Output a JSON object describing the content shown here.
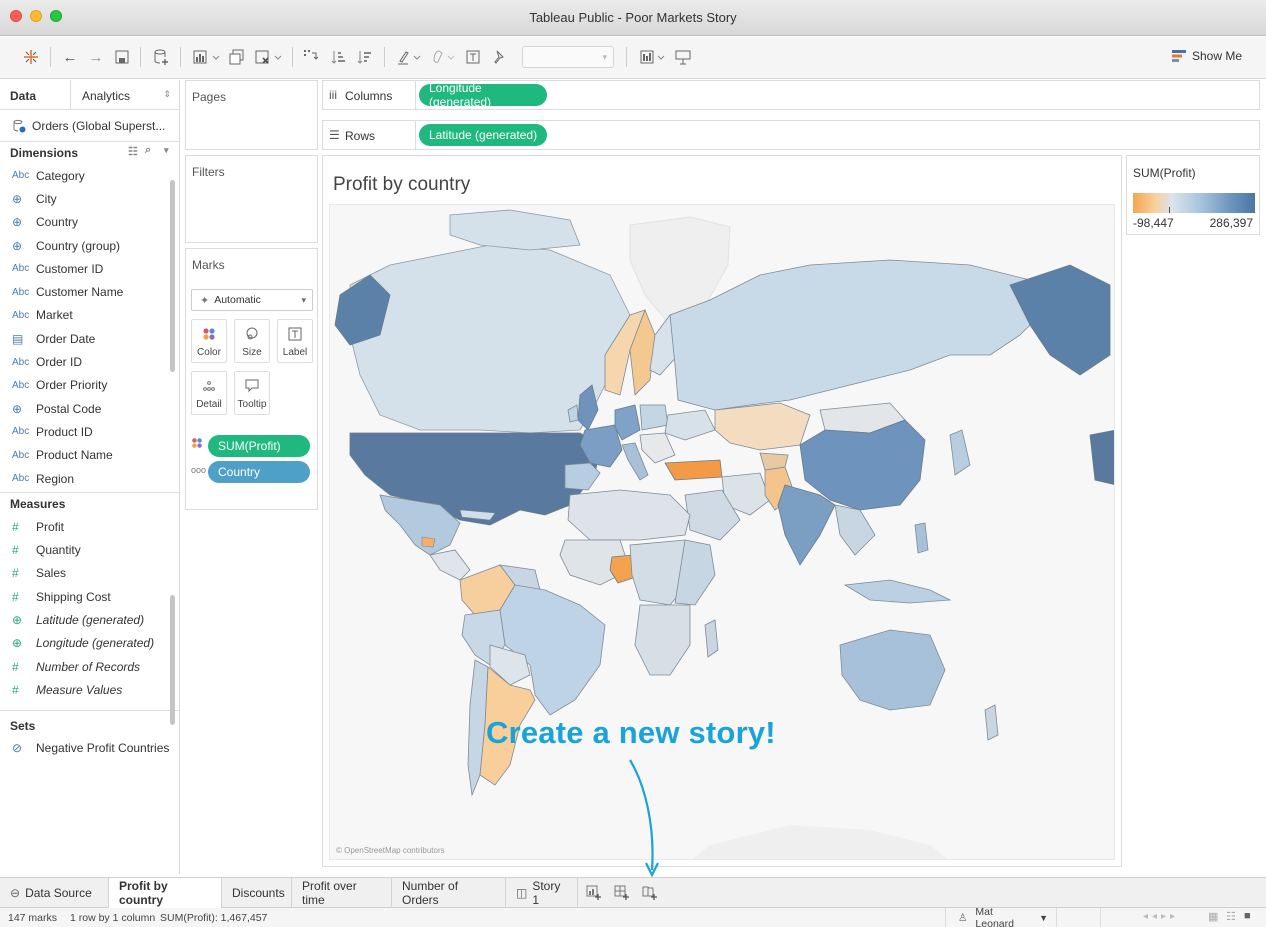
{
  "window": {
    "title": "Tableau Public - Poor Markets Story"
  },
  "toolbar": {
    "show_me_label": "Show Me"
  },
  "left_panel": {
    "tabs": [
      {
        "label": "Data"
      },
      {
        "label": "Analytics"
      }
    ],
    "data_source": "Orders (Global Superst...",
    "dimensions_title": "Dimensions",
    "dimensions": [
      {
        "icon": "abc-icon",
        "label": "Category"
      },
      {
        "icon": "globe-icon",
        "label": "City"
      },
      {
        "icon": "globe-icon",
        "label": "Country"
      },
      {
        "icon": "group-globe-icon",
        "label": "Country (group)"
      },
      {
        "icon": "abc-icon",
        "label": "Customer ID"
      },
      {
        "icon": "abc-icon",
        "label": "Customer Name"
      },
      {
        "icon": "abc-icon",
        "label": "Market"
      },
      {
        "icon": "calendar-icon",
        "label": "Order Date"
      },
      {
        "icon": "abc-icon",
        "label": "Order ID"
      },
      {
        "icon": "abc-icon",
        "label": "Order Priority"
      },
      {
        "icon": "globe-icon",
        "label": "Postal Code"
      },
      {
        "icon": "abc-icon",
        "label": "Product ID"
      },
      {
        "icon": "abc-icon",
        "label": "Product Name"
      },
      {
        "icon": "abc-icon",
        "label": "Region"
      }
    ],
    "measures_title": "Measures",
    "measures": [
      {
        "icon": "hash-icon",
        "label": "Profit"
      },
      {
        "icon": "hash-icon",
        "label": "Quantity"
      },
      {
        "icon": "hash-icon",
        "label": "Sales"
      },
      {
        "icon": "hash-icon",
        "label": "Shipping Cost"
      },
      {
        "icon": "globe-icon",
        "label": "Latitude (generated)"
      },
      {
        "icon": "globe-icon",
        "label": "Longitude (generated)"
      },
      {
        "icon": "hash-icon",
        "label": "Number of Records"
      },
      {
        "icon": "hash-icon",
        "label": "Measure Values"
      }
    ],
    "sets_title": "Sets",
    "sets": [
      {
        "icon": "set-icon",
        "label": "Negative Profit Countries"
      }
    ]
  },
  "cards": {
    "pages": "Pages",
    "filters": "Filters",
    "marks": "Marks",
    "mark_type": "Automatic",
    "mark_buttons": [
      "Color",
      "Size",
      "Label",
      "Detail",
      "Tooltip"
    ],
    "mark_pills": [
      "SUM(Profit)",
      "Country"
    ]
  },
  "shelves": {
    "columns_label": "Columns",
    "columns_pill": "Longitude (generated)",
    "rows_label": "Rows",
    "rows_pill": "Latitude (generated)"
  },
  "viz": {
    "title": "Profit by country",
    "attribution": "© OpenStreetMap contributors"
  },
  "legend": {
    "title": "SUM(Profit)",
    "min": "-98,447",
    "max": "286,397",
    "colors": {
      "negative": "#f3a74f",
      "neutral": "#d9e4ec",
      "positive": "#4b77a3"
    }
  },
  "annotation": {
    "text": "Create a new story!"
  },
  "sheet_tabs": [
    {
      "label": "Data Source"
    },
    {
      "label": "Profit by country"
    },
    {
      "label": "Discounts"
    },
    {
      "label": "Profit over time"
    },
    {
      "label": "Number of Orders"
    },
    {
      "label": "Story 1"
    }
  ],
  "status": {
    "marks": "147 marks",
    "layout": "1 row by 1 column",
    "sum": "SUM(Profit): 1,467,457",
    "user": "Mat Leonard"
  },
  "colors": {
    "pill_green": "#1fb97f",
    "pill_blue": "#4ea0c8",
    "accent_callout": "#19a3d9"
  }
}
